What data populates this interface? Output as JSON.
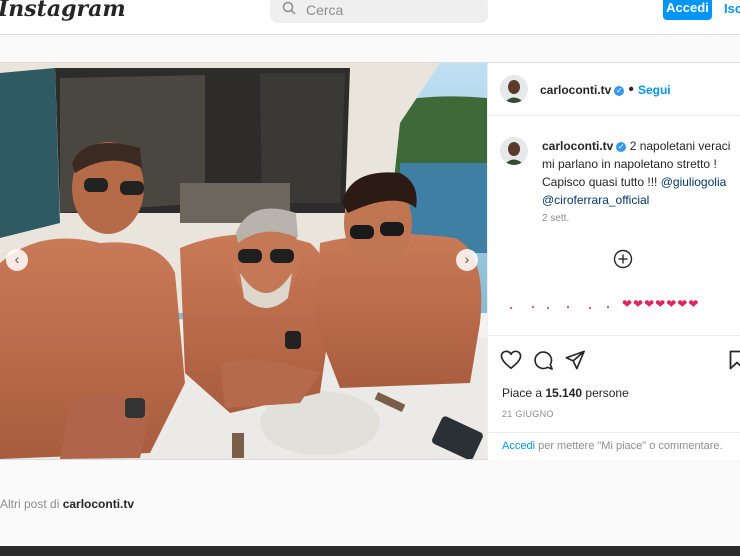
{
  "header": {
    "logo_text": "Instagram",
    "search_placeholder": "Cerca",
    "login_label": "Accedi",
    "signup_label": "Iscr"
  },
  "post": {
    "username": "carloconti.tv",
    "follow_label": "Segui",
    "caption_text": "2 napoletani veraci mi parlano in napoletano stretto ! Capisco quasi tutto !!! ",
    "mentions": [
      "@giuliogolia",
      "@ciroferrara_official"
    ],
    "time_ago": "2 sett.",
    "hearts": "❤❤❤❤❤❤❤",
    "likes_prefix": "Piace a ",
    "likes_count": "15.140",
    "likes_suffix": " persone",
    "date": "21 GIUGNO",
    "login_link": "Accedi",
    "login_suffix": " per mettere \"Mi piace\" o commentare."
  },
  "more_posts": {
    "prefix": "Altri post di ",
    "username": "carloconti.tv"
  },
  "colors": {
    "accent": "#0095f6",
    "heart": "#e0245e",
    "verified": "#3897f0"
  }
}
